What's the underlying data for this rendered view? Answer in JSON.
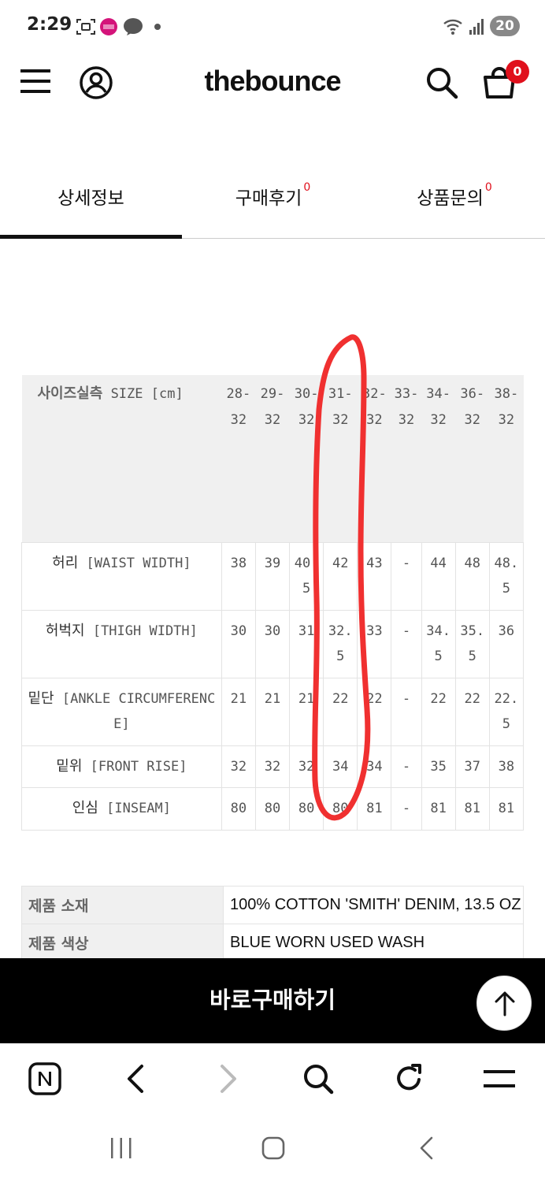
{
  "status_bar": {
    "time": "2:29",
    "battery": "20",
    "icons": [
      "screenshot-icon",
      "busan-app-icon",
      "kakaotalk-icon",
      "wifi-icon",
      "signal-icon"
    ]
  },
  "header": {
    "brand": "thebounce",
    "cart_count": "0"
  },
  "tabs": [
    {
      "label": "상세정보",
      "count": ""
    },
    {
      "label": "구매후기",
      "count": "0"
    },
    {
      "label": "상품문의",
      "count": "0"
    }
  ],
  "size_table": {
    "header": {
      "ko": "사이즈실측",
      "en": "SIZE [cm]"
    },
    "sizes": [
      "28-32",
      "29-32",
      "30-32",
      "31-32",
      "32-32",
      "33-32",
      "34-32",
      "36-32",
      "38-32"
    ],
    "rows": [
      {
        "ko": "허리",
        "en": "[WAIST WIDTH]",
        "values": [
          "38",
          "39",
          "40.5",
          "42",
          "43",
          "-",
          "44",
          "48",
          "48.5"
        ]
      },
      {
        "ko": "허벅지",
        "en": "[THIGH WIDTH]",
        "values": [
          "30",
          "30",
          "31",
          "32.5",
          "33",
          "-",
          "34.5",
          "35.5",
          "36"
        ]
      },
      {
        "ko": "밑단",
        "en": "[ANKLE CIRCUMFERENCE]",
        "values": [
          "21",
          "21",
          "21",
          "22",
          "22",
          "-",
          "22",
          "22",
          "22.5"
        ]
      },
      {
        "ko": "밑위",
        "en": "[FRONT RISE]",
        "values": [
          "32",
          "32",
          "32",
          "34",
          "34",
          "-",
          "35",
          "37",
          "38"
        ]
      },
      {
        "ko": "인심",
        "en": "[INSEAM]",
        "values": [
          "80",
          "80",
          "80",
          "80",
          "81",
          "-",
          "81",
          "81",
          "81"
        ]
      }
    ]
  },
  "product_info": [
    {
      "label": "제품 소재",
      "value": "100% COTTON 'SMITH' DENIM, 13.5 OZ"
    },
    {
      "label": "제품 색상",
      "value": "BLUE WORN USED WASH"
    }
  ],
  "buy_button": {
    "label": "바로구매하기"
  },
  "annotation": {
    "color": "#f03030"
  },
  "colors": {
    "accent": "#e0101c",
    "buy_bar": "#000000"
  }
}
